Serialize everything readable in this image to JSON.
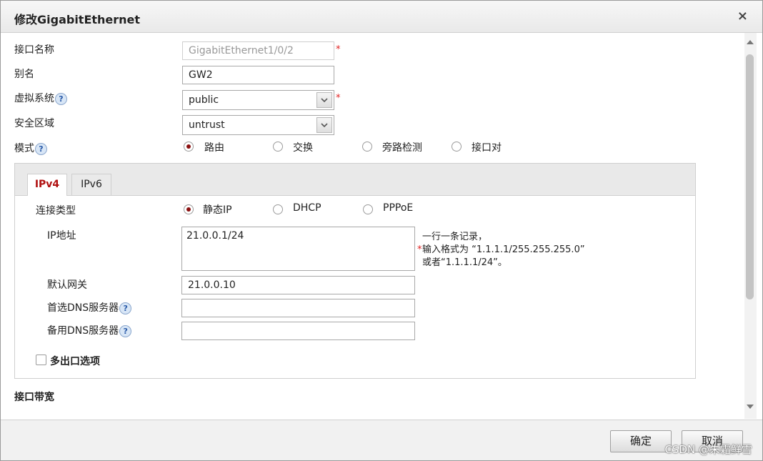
{
  "dialog": {
    "title": "修改GigabitEthernet",
    "close_symbol": "×"
  },
  "form": {
    "interface_name": {
      "label": "接口名称",
      "value": "GigabitEthernet1/0/2",
      "required": "*"
    },
    "alias": {
      "label": "别名",
      "value": "GW2"
    },
    "virtual_system": {
      "label": "虚拟系统",
      "value": "public",
      "required": "*",
      "help": "?"
    },
    "security_zone": {
      "label": "安全区域",
      "value": "untrust"
    },
    "mode": {
      "label": "模式",
      "help": "?",
      "options": [
        "路由",
        "交换",
        "旁路检测",
        "接口对"
      ],
      "selected": "路由"
    }
  },
  "tabs": {
    "items": [
      "IPv4",
      "IPv6"
    ],
    "active": "IPv4"
  },
  "ipv4": {
    "connection_type": {
      "label": "连接类型",
      "options": [
        "静态IP",
        "DHCP",
        "PPPoE"
      ],
      "selected": "静态IP"
    },
    "ip_address": {
      "label": "IP地址",
      "value": "21.0.0.1/24",
      "hint_line1": "一行一条记录，",
      "hint_star": "*",
      "hint_line2": "输入格式为 “1.1.1.1/255.255.255.0”",
      "hint_line3": "或者“1.1.1.1/24”。"
    },
    "default_gateway": {
      "label": "默认网关",
      "value": "21.0.0.10"
    },
    "preferred_dns": {
      "label": "首选DNS服务器",
      "value": "",
      "help": "?"
    },
    "backup_dns": {
      "label": "备用DNS服务器",
      "value": "",
      "help": "?"
    },
    "multi_egress": {
      "label": "多出口选项",
      "checked": false
    }
  },
  "bandwidth": {
    "label": "接口带宽"
  },
  "footer": {
    "ok_label": "确定",
    "cancel_label": "取消"
  },
  "watermark": "CSDN @朱霜鲜雪",
  "colors": {
    "accent": "#b01010",
    "required": "#e02020",
    "help": "#2a5aa8"
  }
}
